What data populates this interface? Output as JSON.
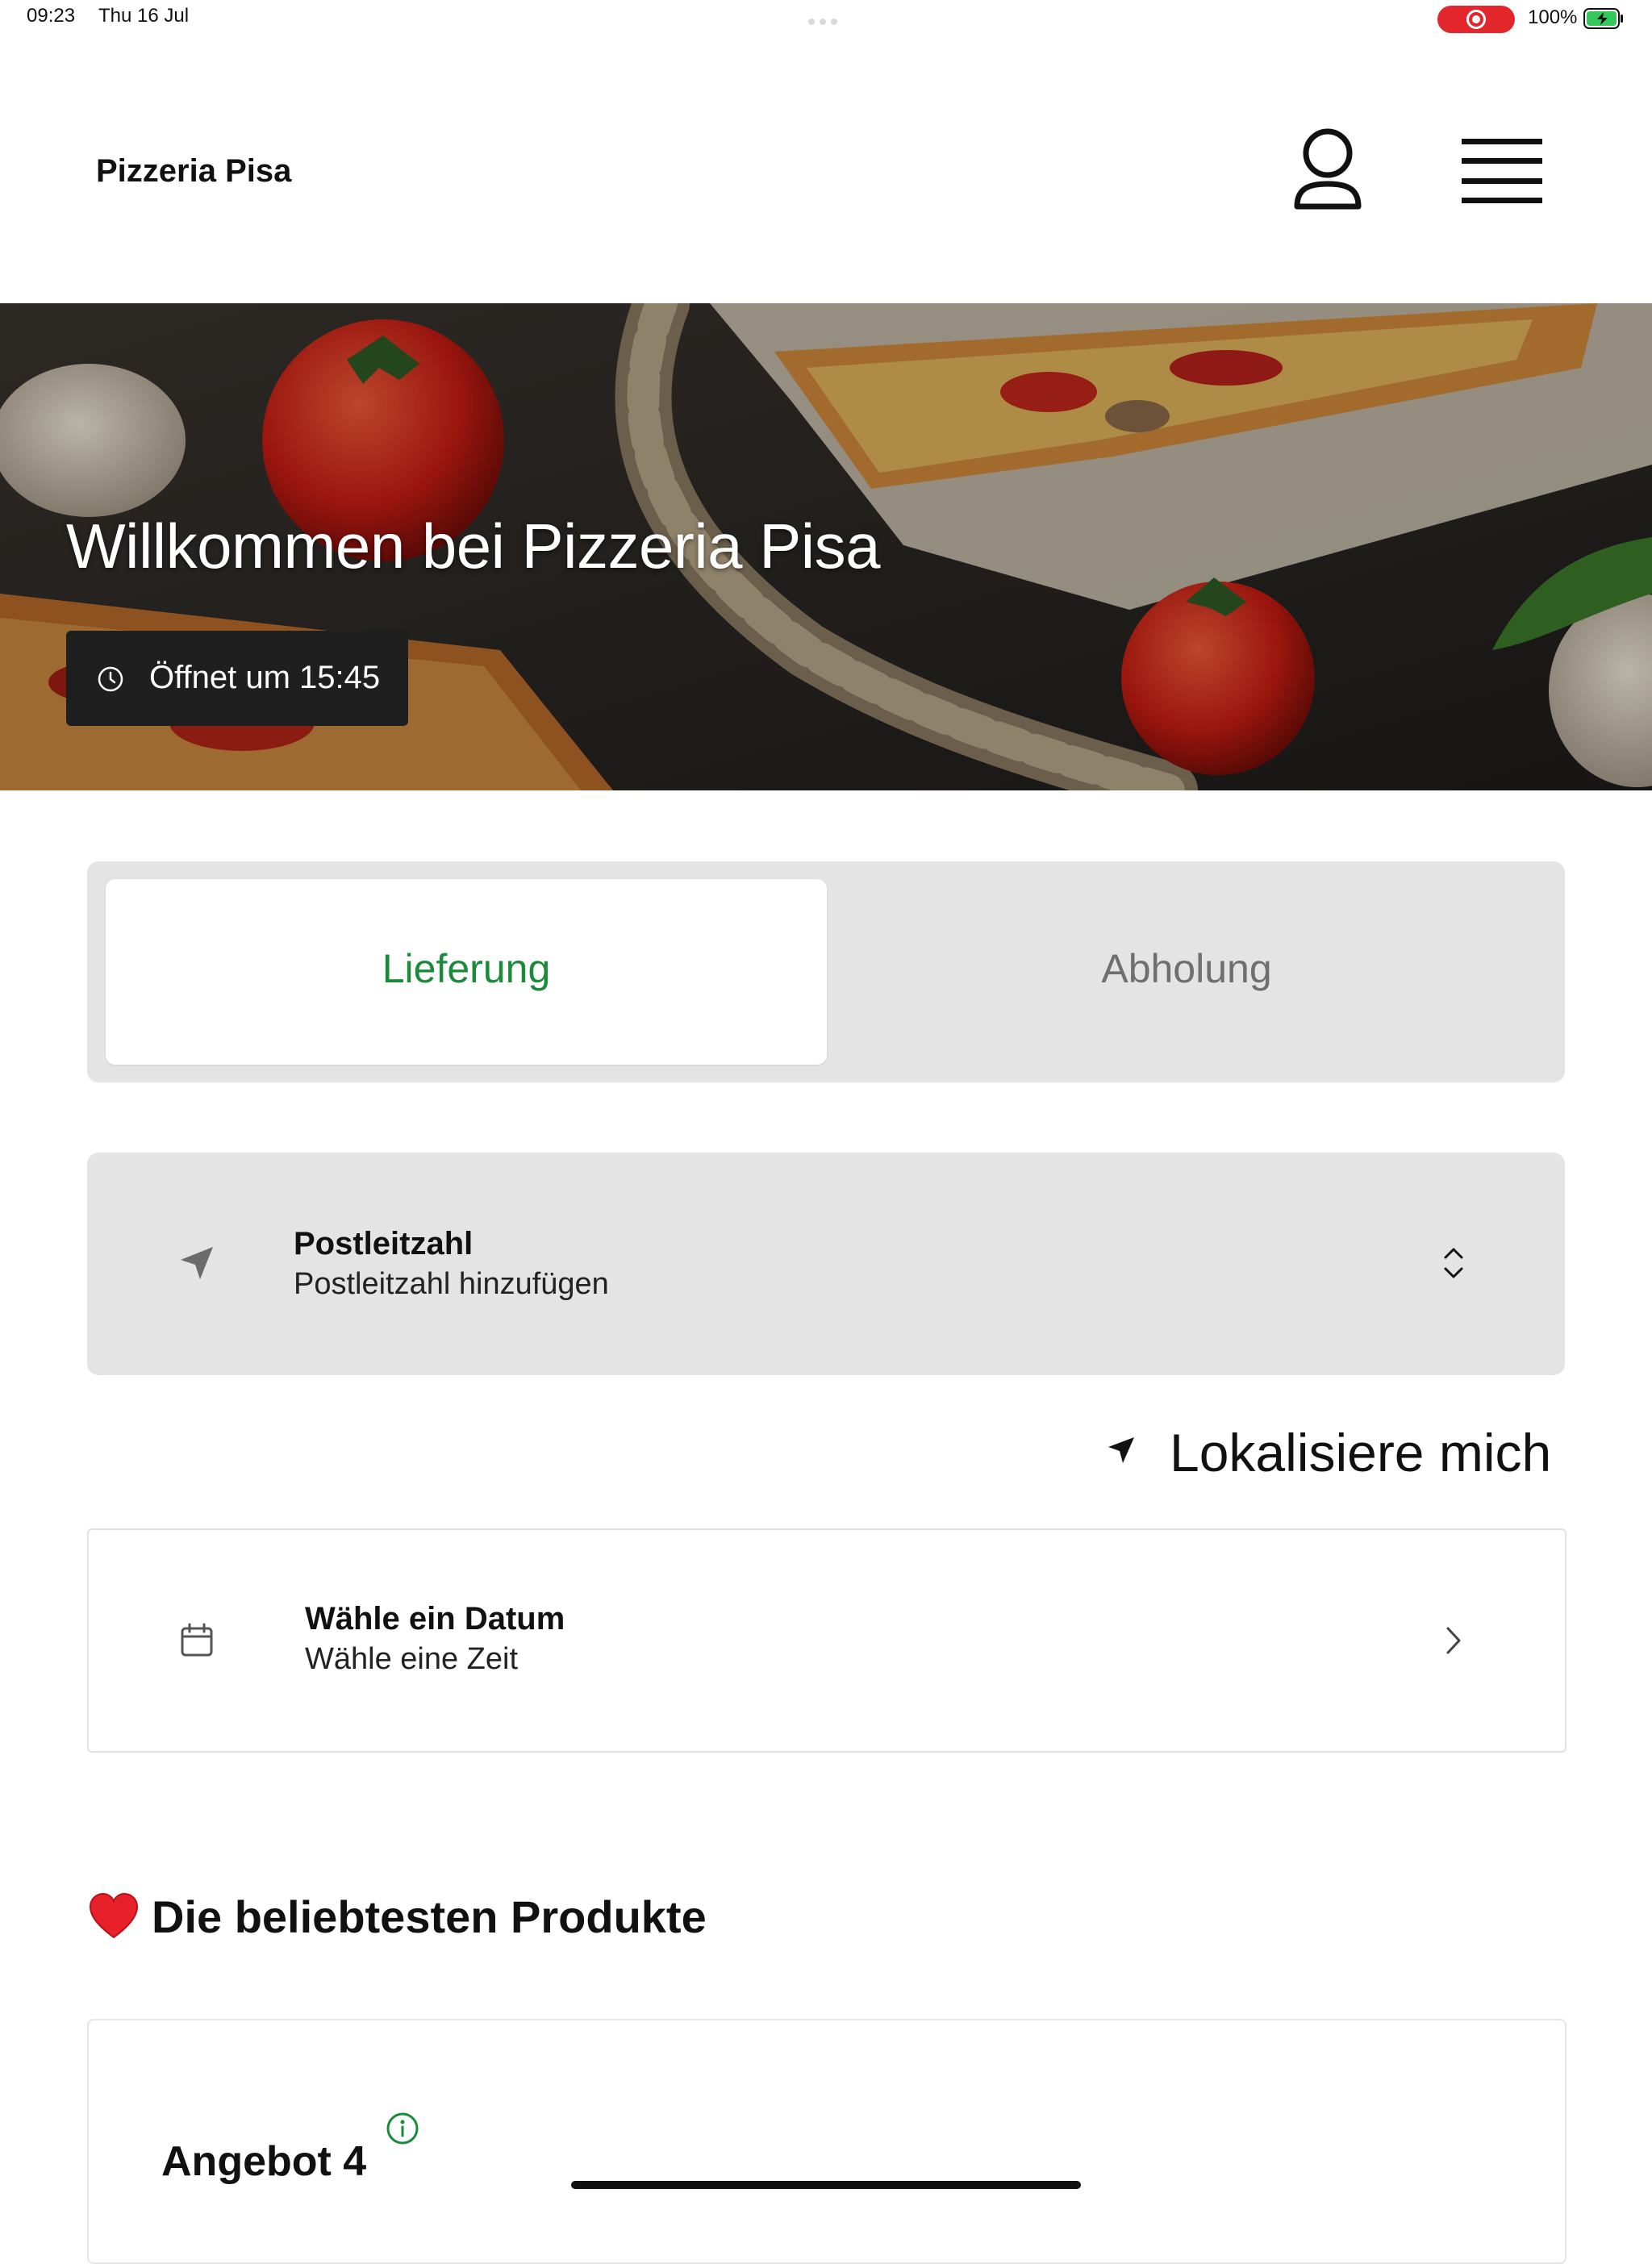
{
  "status_bar": {
    "time": "09:23",
    "date": "Thu 16 Jul",
    "battery_percent": "100%",
    "battery_level": 1.0,
    "recording": true
  },
  "header": {
    "brand": "Pizzeria Pisa",
    "account_icon": "user-icon",
    "menu_icon": "hamburger-menu-icon"
  },
  "hero": {
    "title": "Willkommen bei Pizzeria Pisa",
    "hours_badge": "Öffnet um 15:45",
    "hours_icon": "clock-icon"
  },
  "order_mode": {
    "options": [
      {
        "label": "Lieferung",
        "selected": true
      },
      {
        "label": "Abholung",
        "selected": false
      }
    ],
    "active_color": "#1b8a3a"
  },
  "postcode": {
    "title": "Postleitzahl",
    "placeholder": "Postleitzahl hinzufügen",
    "icon": "location-arrow-icon"
  },
  "locate": {
    "label": "Lokalisiere mich",
    "icon": "location-arrow-icon"
  },
  "schedule": {
    "title": "Wähle ein Datum",
    "subtitle": "Wähle eine Zeit",
    "icon": "calendar-icon"
  },
  "popular": {
    "title": "Die beliebtesten Produkte",
    "icon": "heart-icon",
    "products": [
      {
        "name": "Angebot 4"
      }
    ]
  }
}
